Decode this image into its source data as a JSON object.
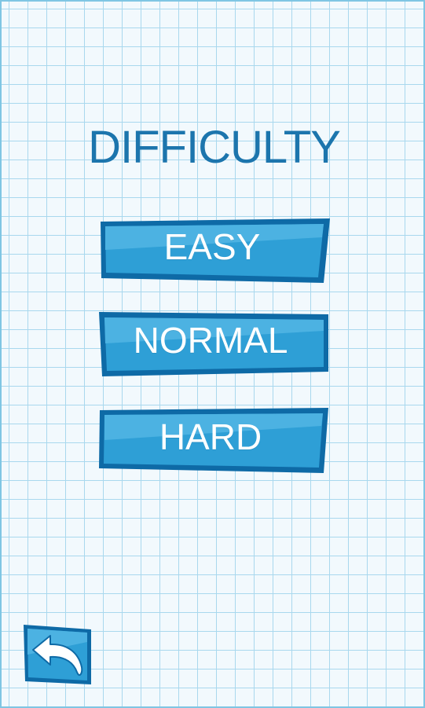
{
  "screen": {
    "title": "DIFFICULTY"
  },
  "buttons": {
    "easy": "EASY",
    "normal": "NORMAL",
    "hard": "HARD"
  },
  "back": {
    "icon": "back-arrow-icon"
  },
  "colors": {
    "grid_background": "#f2f9fd",
    "grid_lines": "#a9d8ee",
    "title": "#1c75ad",
    "button_fill": "#2e9fd6",
    "button_dark": "#0e6aa6",
    "button_highlight": "#4cb2e2",
    "button_text": "#ffffff"
  }
}
